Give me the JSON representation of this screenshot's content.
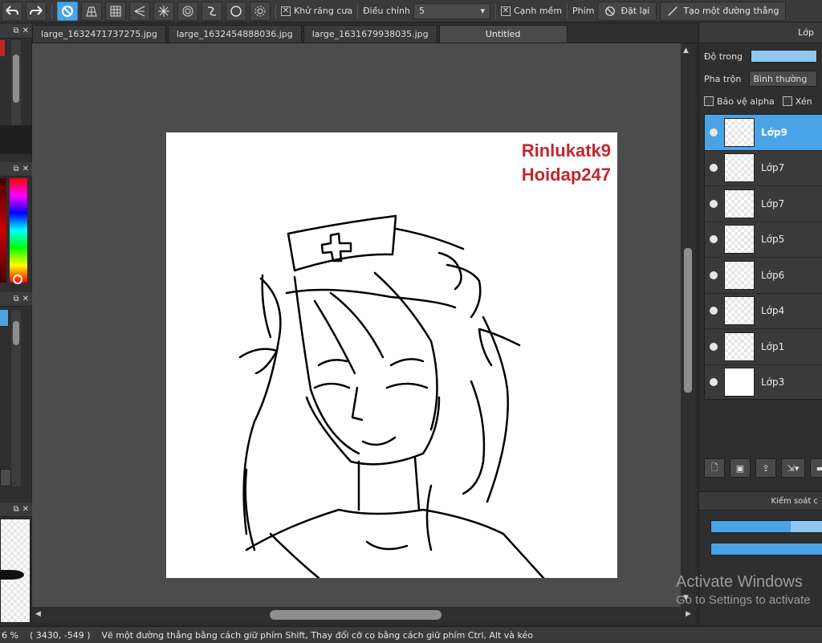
{
  "toolbar": {
    "antialias_label": "Khử răng cưa",
    "adjust_label": "Điều chỉnh",
    "adjust_value": "5",
    "edge_label": "Cạnh mềm",
    "shortcut_label": "Phím",
    "reset_label": "Đặt lại",
    "create_line_label": "Tạo một đường thẳng"
  },
  "tabs": [
    {
      "label": "large_1632471737275.jpg"
    },
    {
      "label": "large_1632454888036.jpg"
    },
    {
      "label": "large_1631679938035.jpg"
    },
    {
      "label": "Untitled"
    }
  ],
  "canvas": {
    "watermark_line1": "Rinlukatk9",
    "watermark_line2": "Hoidap247"
  },
  "layer_panel": {
    "title": "Lớp",
    "opacity_label": "Độ trong",
    "blend_label": "Pha trộn",
    "blend_value": "Bình thường",
    "protect_alpha_label": "Bảo vệ alpha",
    "clip_label": "Xén",
    "layers": [
      {
        "name": "Lớp9",
        "active": true
      },
      {
        "name": "Lớp7",
        "active": false
      },
      {
        "name": "Lớp7",
        "active": false
      },
      {
        "name": "Lớp5",
        "active": false
      },
      {
        "name": "Lớp6",
        "active": false
      },
      {
        "name": "Lớp4",
        "active": false
      },
      {
        "name": "Lớp1",
        "active": false
      },
      {
        "name": "Lớp3",
        "active": false
      }
    ]
  },
  "control_panel": {
    "title": "Kiểm soát c",
    "bar1_fill": 0.72,
    "bar2_fill": 1.0
  },
  "windows_activation": {
    "title": "Activate Windows",
    "subtitle": "Go to Settings to activate"
  },
  "statusbar": {
    "zoom": "6 %",
    "coords": "( 3430, -549 )",
    "hint": "Vẽ một đường thẳng bằng cách giữ phím Shift, Thay đổi cỡ cọ bằng cách giữ phím Ctrl, Alt và kéo"
  },
  "colors": {
    "accent": "#4aa3e6",
    "watermark": "#c0272d",
    "panel": "#2f2f2f",
    "canvas_bg": "#4c4c4c"
  }
}
